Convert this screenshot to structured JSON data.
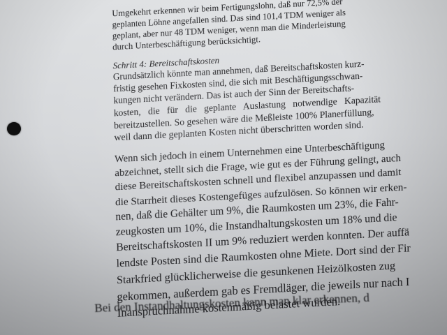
{
  "paragraph_1": {
    "lines": [
      "Umgekehrt erkennen wir beim Fertigungslohn, daß nur 72,5% der",
      "geplanten Löhne angefallen sind. Das sind 101,4 TDM weniger als",
      "geplant, aber nur 48 TDM weniger, wenn man die Minderleistung",
      "durch Unterbeschäftigung berücksichtigt."
    ]
  },
  "section_heading": "Schritt 4: Bereitschaftskosten",
  "paragraph_2": {
    "lines": [
      "Grundsätzlich könnte man annehmen, daß Bereitschaftskosten kurz-",
      "fristig gesehen Fixkosten sind, die sich mit Beschäftigungsschwan-",
      "kungen nicht verändern. Das ist auch der Sinn der Bereitschafts-",
      "kosten, die für die geplante Auslastung notwendige Kapazität",
      "bereitzustellen. So gesehen wäre die Meßleiste 100% Planerfüllung,",
      "weil dann die geplanten Kosten nicht überschritten worden sind."
    ]
  },
  "paragraph_3": {
    "lines": [
      "Wenn sich jedoch in einem Unternehmen eine Unterbeschäftigung",
      "abzeichnet, stellt sich die Frage, wie gut es der Führung gelingt, auch",
      "diese Bereitschaftskosten schnell und flexibel anzupassen und damit",
      "die Starrheit dieses Kostengefüges aufzulösen. So können wir erken-",
      "nen, daß die Gehälter um 9%, die Raumkosten um 23%, die Fahr-",
      "zeugkosten um 10%, die Instandhaltungskosten um 18% und die",
      "Bereitschaftskosten II um 9% reduziert werden konnten. Der auffä",
      "lendste Posten sind die Raumkosten ohne Miete. Dort sind der Fir",
      "Starkfried glücklicherweise die gesunkenen Heizölkosten zug",
      "gekommen, außerdem gab es Fremdläger, die jeweils nur nach I",
      "Inanspruchnahme kostenmäßig belastet wurden."
    ]
  },
  "paragraph_4": {
    "lines": [
      "Bei den Instandhaltungskosten kann man klar erkennen, d"
    ]
  }
}
